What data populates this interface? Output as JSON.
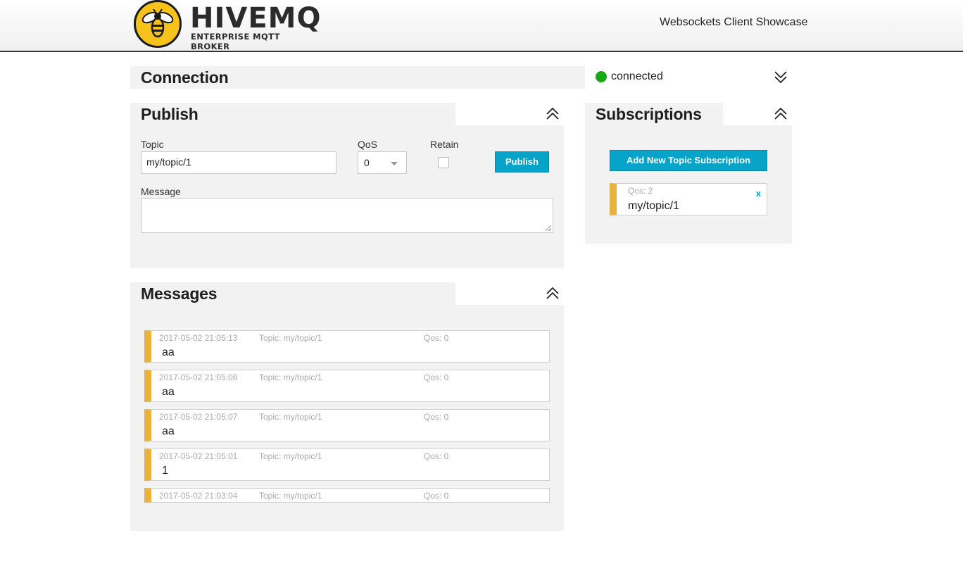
{
  "header": {
    "logo_word": "HIVEMQ",
    "logo_sub": "ENTERPRISE MQTT BROKER",
    "app_title": "Websockets Client Showcase"
  },
  "connection": {
    "title": "Connection",
    "status": "connected",
    "status_color": "#17a817",
    "toggle_icon": "chevron-double-down-icon"
  },
  "publish": {
    "title": "Publish",
    "toggle_icon": "chevron-double-up-icon",
    "topic_label": "Topic",
    "topic_value": "my/topic/1",
    "qos_label": "QoS",
    "qos_value": "0",
    "retain_label": "Retain",
    "retain_checked": false,
    "button_label": "Publish",
    "message_label": "Message",
    "message_value": ""
  },
  "messages": {
    "title": "Messages",
    "toggle_icon": "chevron-double-up-icon",
    "items": [
      {
        "timestamp": "2017-05-02 21:05:13",
        "topic": "Topic: my/topic/1",
        "qos": "Qos: 0",
        "body": "aa"
      },
      {
        "timestamp": "2017-05-02 21:05:08",
        "topic": "Topic: my/topic/1",
        "qos": "Qos: 0",
        "body": "aa"
      },
      {
        "timestamp": "2017-05-02 21:05:07",
        "topic": "Topic: my/topic/1",
        "qos": "Qos: 0",
        "body": "aa"
      },
      {
        "timestamp": "2017-05-02 21:05:01",
        "topic": "Topic: my/topic/1",
        "qos": "Qos: 0",
        "body": "1"
      },
      {
        "timestamp": "2017-05-02 21:03:04",
        "topic": "Topic: my/topic/1",
        "qos": "Qos: 0",
        "body": ""
      }
    ]
  },
  "subscriptions": {
    "title": "Subscriptions",
    "toggle_icon": "chevron-double-up-icon",
    "add_button_label": "Add New Topic Subscription",
    "items": [
      {
        "qos": "Qos: 2",
        "topic": "my/topic/1",
        "close_label": "x"
      }
    ]
  },
  "colors": {
    "accent": "#07a3c8",
    "message_bar": "#e8b33d",
    "panel_bg": "#f2f2f2",
    "brand_yellow": "#f7c31b"
  }
}
